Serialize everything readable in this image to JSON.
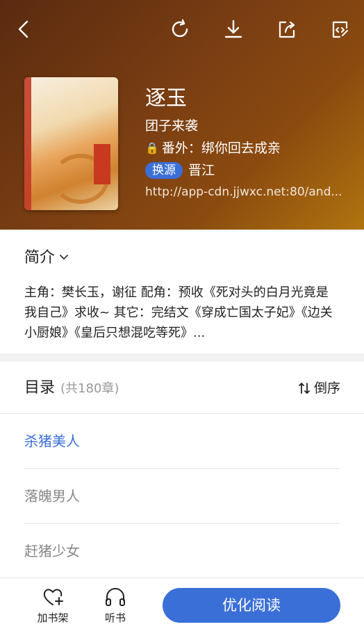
{
  "book": {
    "title": "逐玉",
    "author": "团子来袭",
    "extra_label": "番外：绑你回去成亲",
    "source_button": "换源",
    "source_name": "晋江",
    "url": "http://app-cdn.jjwxc.net:80/and..."
  },
  "intro": {
    "heading": "简介",
    "text": "主角：樊长玉，谢征 配角：预收《死对头的白月光竟是我自己》求收~ 其它：完结文《穿成亡国太子妃》《边关小厨娘》《皇后只想混吃等死》..."
  },
  "toc": {
    "heading": "目录",
    "count": "(共180章)",
    "sort_label": "倒序",
    "chapters": [
      "杀猪美人",
      "落魄男人",
      "赶猪少女"
    ]
  },
  "bottom": {
    "add_shelf": "加书架",
    "listen": "听书",
    "read": "优化阅读"
  },
  "colors": {
    "accent": "#3b6fd8",
    "header_dark": "#5a2a10",
    "header_light": "#b0740e"
  }
}
